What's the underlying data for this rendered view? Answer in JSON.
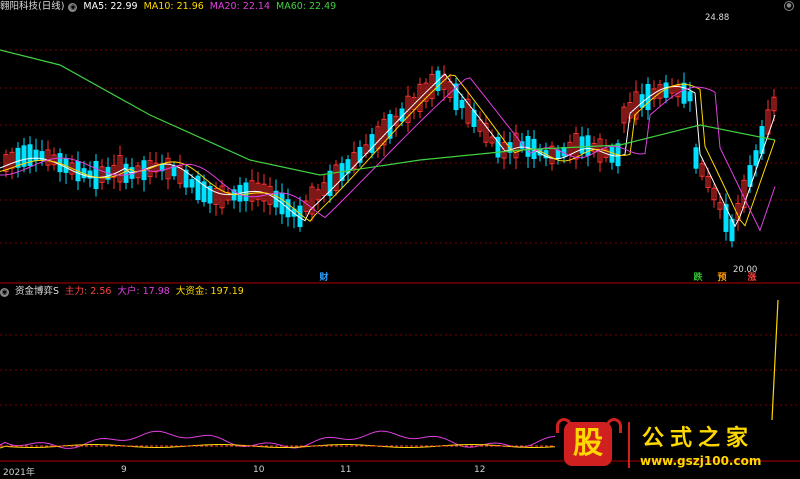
{
  "stock": {
    "title": "翱阳科技(日线)",
    "ma": [
      {
        "label": "MA5: 22.99",
        "color": "#ffffff"
      },
      {
        "label": "MA10: 21.96",
        "color": "#ffd800"
      },
      {
        "label": "MA20: 22.14",
        "color": "#e040e0"
      },
      {
        "label": "MA60: 22.49",
        "color": "#40d040"
      }
    ],
    "high_label": "24.88",
    "low_label": "20.00",
    "tags": [
      {
        "text": "财",
        "color": "#2aa0ff"
      },
      {
        "text": "跌",
        "color": "#30c030"
      },
      {
        "text": "预",
        "color": "#ff9900"
      },
      {
        "text": "涨",
        "color": "#ff4040"
      }
    ]
  },
  "indicator": {
    "name": "资金博弈S",
    "items": [
      {
        "label": "主力: 2.56",
        "color": "#ff4040"
      },
      {
        "label": "大户: 17.98",
        "color": "#e040e0"
      },
      {
        "label": "大资金: 197.19",
        "color": "#ffd800"
      }
    ]
  },
  "x_axis": {
    "labels": [
      "2021年",
      "9",
      "10",
      "11",
      "12"
    ]
  },
  "logo": {
    "glyph": "股",
    "title": "公式之家",
    "url": "www.gszj100.com"
  },
  "colors": {
    "up": "#ff3030",
    "down": "#00e0ff",
    "grid": "#7a0000"
  }
}
